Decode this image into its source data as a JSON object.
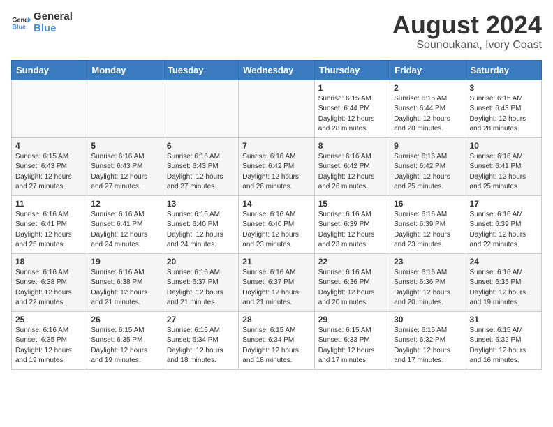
{
  "header": {
    "logo_general": "General",
    "logo_blue": "Blue",
    "main_title": "August 2024",
    "subtitle": "Sounoukana, Ivory Coast"
  },
  "weekdays": [
    "Sunday",
    "Monday",
    "Tuesday",
    "Wednesday",
    "Thursday",
    "Friday",
    "Saturday"
  ],
  "weeks": [
    [
      {
        "day": "",
        "info": ""
      },
      {
        "day": "",
        "info": ""
      },
      {
        "day": "",
        "info": ""
      },
      {
        "day": "",
        "info": ""
      },
      {
        "day": "1",
        "info": "Sunrise: 6:15 AM\nSunset: 6:44 PM\nDaylight: 12 hours\nand 28 minutes."
      },
      {
        "day": "2",
        "info": "Sunrise: 6:15 AM\nSunset: 6:44 PM\nDaylight: 12 hours\nand 28 minutes."
      },
      {
        "day": "3",
        "info": "Sunrise: 6:15 AM\nSunset: 6:43 PM\nDaylight: 12 hours\nand 28 minutes."
      }
    ],
    [
      {
        "day": "4",
        "info": "Sunrise: 6:15 AM\nSunset: 6:43 PM\nDaylight: 12 hours\nand 27 minutes."
      },
      {
        "day": "5",
        "info": "Sunrise: 6:16 AM\nSunset: 6:43 PM\nDaylight: 12 hours\nand 27 minutes."
      },
      {
        "day": "6",
        "info": "Sunrise: 6:16 AM\nSunset: 6:43 PM\nDaylight: 12 hours\nand 27 minutes."
      },
      {
        "day": "7",
        "info": "Sunrise: 6:16 AM\nSunset: 6:42 PM\nDaylight: 12 hours\nand 26 minutes."
      },
      {
        "day": "8",
        "info": "Sunrise: 6:16 AM\nSunset: 6:42 PM\nDaylight: 12 hours\nand 26 minutes."
      },
      {
        "day": "9",
        "info": "Sunrise: 6:16 AM\nSunset: 6:42 PM\nDaylight: 12 hours\nand 25 minutes."
      },
      {
        "day": "10",
        "info": "Sunrise: 6:16 AM\nSunset: 6:41 PM\nDaylight: 12 hours\nand 25 minutes."
      }
    ],
    [
      {
        "day": "11",
        "info": "Sunrise: 6:16 AM\nSunset: 6:41 PM\nDaylight: 12 hours\nand 25 minutes."
      },
      {
        "day": "12",
        "info": "Sunrise: 6:16 AM\nSunset: 6:41 PM\nDaylight: 12 hours\nand 24 minutes."
      },
      {
        "day": "13",
        "info": "Sunrise: 6:16 AM\nSunset: 6:40 PM\nDaylight: 12 hours\nand 24 minutes."
      },
      {
        "day": "14",
        "info": "Sunrise: 6:16 AM\nSunset: 6:40 PM\nDaylight: 12 hours\nand 23 minutes."
      },
      {
        "day": "15",
        "info": "Sunrise: 6:16 AM\nSunset: 6:39 PM\nDaylight: 12 hours\nand 23 minutes."
      },
      {
        "day": "16",
        "info": "Sunrise: 6:16 AM\nSunset: 6:39 PM\nDaylight: 12 hours\nand 23 minutes."
      },
      {
        "day": "17",
        "info": "Sunrise: 6:16 AM\nSunset: 6:39 PM\nDaylight: 12 hours\nand 22 minutes."
      }
    ],
    [
      {
        "day": "18",
        "info": "Sunrise: 6:16 AM\nSunset: 6:38 PM\nDaylight: 12 hours\nand 22 minutes."
      },
      {
        "day": "19",
        "info": "Sunrise: 6:16 AM\nSunset: 6:38 PM\nDaylight: 12 hours\nand 21 minutes."
      },
      {
        "day": "20",
        "info": "Sunrise: 6:16 AM\nSunset: 6:37 PM\nDaylight: 12 hours\nand 21 minutes."
      },
      {
        "day": "21",
        "info": "Sunrise: 6:16 AM\nSunset: 6:37 PM\nDaylight: 12 hours\nand 21 minutes."
      },
      {
        "day": "22",
        "info": "Sunrise: 6:16 AM\nSunset: 6:36 PM\nDaylight: 12 hours\nand 20 minutes."
      },
      {
        "day": "23",
        "info": "Sunrise: 6:16 AM\nSunset: 6:36 PM\nDaylight: 12 hours\nand 20 minutes."
      },
      {
        "day": "24",
        "info": "Sunrise: 6:16 AM\nSunset: 6:35 PM\nDaylight: 12 hours\nand 19 minutes."
      }
    ],
    [
      {
        "day": "25",
        "info": "Sunrise: 6:16 AM\nSunset: 6:35 PM\nDaylight: 12 hours\nand 19 minutes."
      },
      {
        "day": "26",
        "info": "Sunrise: 6:15 AM\nSunset: 6:35 PM\nDaylight: 12 hours\nand 19 minutes."
      },
      {
        "day": "27",
        "info": "Sunrise: 6:15 AM\nSunset: 6:34 PM\nDaylight: 12 hours\nand 18 minutes."
      },
      {
        "day": "28",
        "info": "Sunrise: 6:15 AM\nSunset: 6:34 PM\nDaylight: 12 hours\nand 18 minutes."
      },
      {
        "day": "29",
        "info": "Sunrise: 6:15 AM\nSunset: 6:33 PM\nDaylight: 12 hours\nand 17 minutes."
      },
      {
        "day": "30",
        "info": "Sunrise: 6:15 AM\nSunset: 6:32 PM\nDaylight: 12 hours\nand 17 minutes."
      },
      {
        "day": "31",
        "info": "Sunrise: 6:15 AM\nSunset: 6:32 PM\nDaylight: 12 hours\nand 16 minutes."
      }
    ]
  ]
}
